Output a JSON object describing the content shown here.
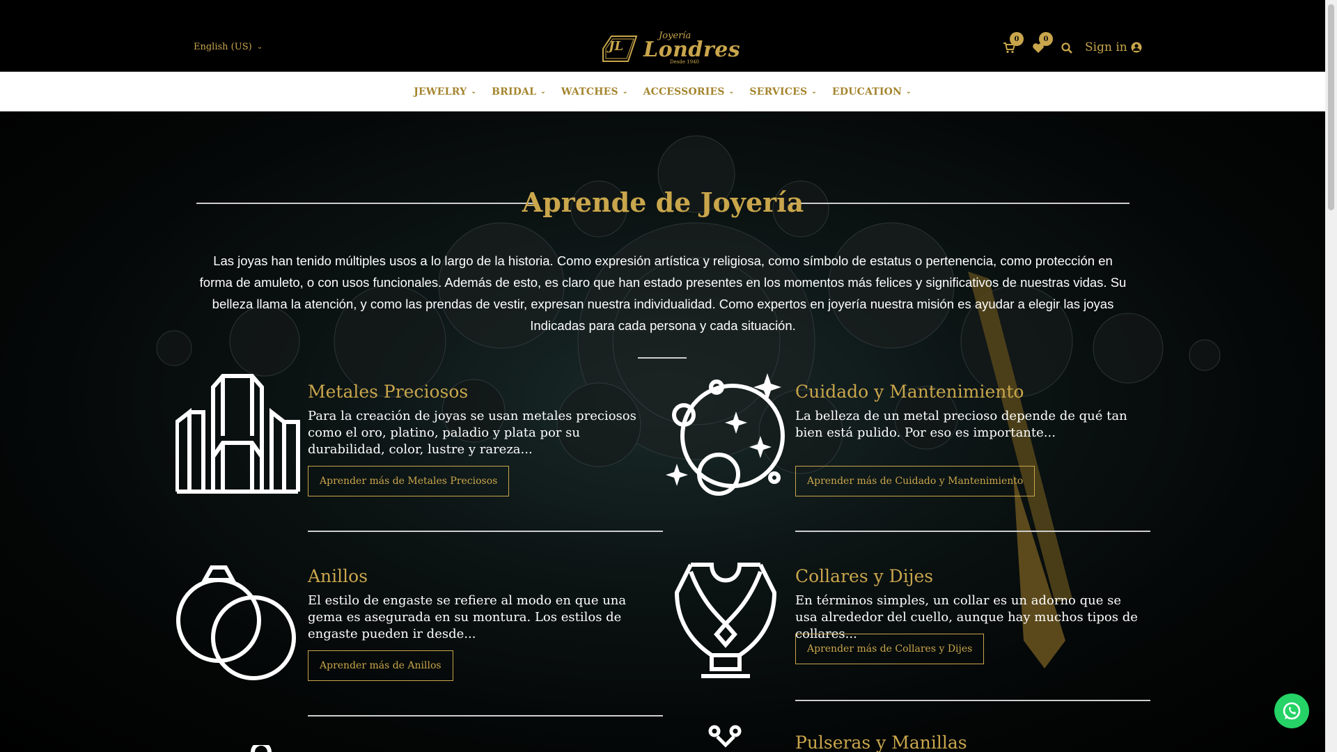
{
  "header": {
    "language": "English (US)",
    "logo": {
      "mark": "JL",
      "small": "Joyería",
      "big": "Londres",
      "tag": "Desde 1940"
    },
    "cart_count": "0",
    "wishlist_count": "0",
    "sign_in": "Sign in"
  },
  "nav": {
    "items": [
      {
        "label": "JEWELRY"
      },
      {
        "label": "BRIDAL"
      },
      {
        "label": "WATCHES"
      },
      {
        "label": "ACCESSORIES"
      },
      {
        "label": "SERVICES"
      },
      {
        "label": "EDUCATION"
      }
    ]
  },
  "main": {
    "title": "Aprende de Joyería",
    "intro": "Las joyas han tenido múltiples usos a lo largo de la historia. Como expresión artística y religiosa, como símbolo de estatus o pertenencia, como protección en forma de amuleto, o con usos funcionales.  Además de esto, es claro que han estado presentes en los momentos más felices y significativos de nuestras vidas. Su belleza llama la atención, y como las prendas de vestir, expresan nuestra individualidad. Como expertos en joyería nuestra misión es ayudar a elegir las joyas Indicadas para cada persona y cada situación.",
    "cards": [
      {
        "title": "Metales Preciosos",
        "text": "Para la creación de joyas se usan metales preciosos como el oro, platino, paladio y plata por su durabilidad, color, lustre y rareza...",
        "button": "Aprender más de Metales Preciosos",
        "icon": "gold-bars-icon"
      },
      {
        "title": "Cuidado y Mantenimiento",
        "text": "La belleza de un metal precioso depende de qué tan bien está pulido. Por eso es importante...",
        "button": "Aprender más de Cuidado y Mantenimiento",
        "icon": "sparkle-bubbles-icon"
      },
      {
        "title": "Anillos",
        "text": "El estilo de engaste se refiere al modo en que una gema es asegurada en su montura. Los estilos de engaste pueden ir desde...",
        "button": "Aprender más de Anillos",
        "icon": "rings-icon"
      },
      {
        "title": "Collares y Dijes",
        "text": "En términos simples, un collar es un adorno que se usa alrededor del cuello, aunque hay muchos tipos de collares...",
        "button": "Aprender más de Collares y Dijes",
        "icon": "necklace-bust-icon"
      },
      {
        "title": "Pulseras y Manillas",
        "icon": "bracelet-icon"
      }
    ]
  },
  "colors": {
    "gold": "#c9a64c",
    "nav_gold": "#a4852f",
    "whatsapp": "#25d366"
  }
}
